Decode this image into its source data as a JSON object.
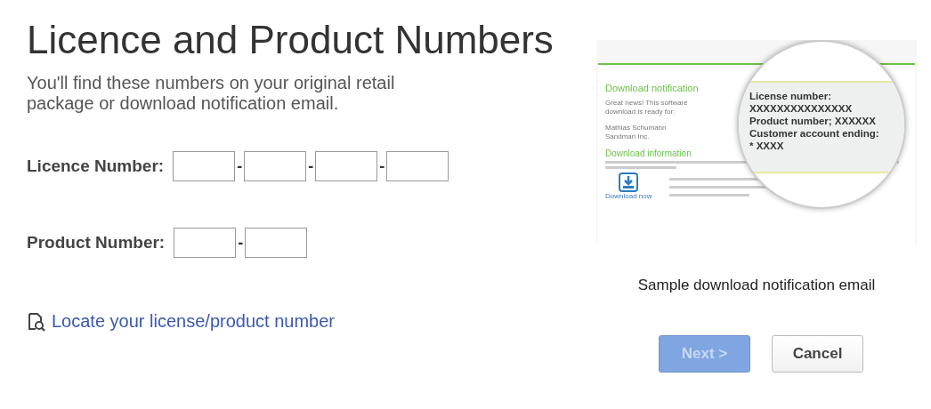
{
  "title": "Licence and Product Numbers",
  "subtitle": "You'll find these numbers on your original retail package or download notification email.",
  "fields": [
    {
      "label": "Licence Number:",
      "segments": [
        {
          "kind": "box"
        },
        {
          "kind": "box"
        },
        {
          "kind": "box"
        },
        {
          "kind": "box"
        }
      ],
      "separator": "-"
    },
    {
      "label": "Product Number:",
      "segments": [
        {
          "kind": "box"
        },
        {
          "kind": "box"
        }
      ],
      "separator": "-"
    }
  ],
  "locate_link": "Locate your license/product number",
  "sample": {
    "heading": "Download notification",
    "intro": "Great news! This software download is ready for:",
    "name_lines": [
      "Mathias Schumann",
      "Sandman Inc."
    ],
    "info_heading": "Download information",
    "download_label": "Download now",
    "magnifier_lines": [
      "License number:",
      "XXXXXXXXXXXXXXX",
      "Product number; XXXXXX",
      "Customer account ending:",
      "* XXXX"
    ]
  },
  "caption": "Sample download notification email",
  "buttons": [
    {
      "label": "Next >",
      "kind": "primary",
      "disabled": true
    },
    {
      "label": "Cancel",
      "kind": "secondary",
      "disabled": false
    }
  ]
}
